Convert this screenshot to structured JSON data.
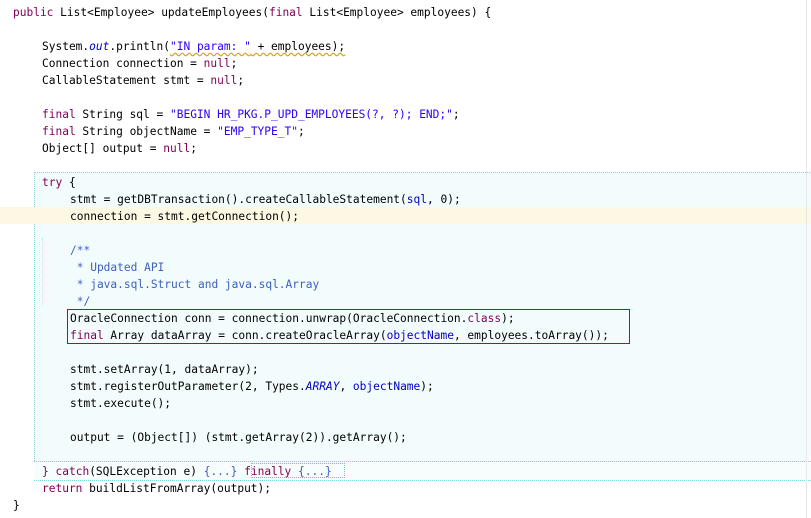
{
  "lines": [
    {
      "id": "l1",
      "segments": [
        {
          "t": "public",
          "c": "kw"
        },
        {
          "t": " List<Employee> updateEmployees(",
          "c": ""
        },
        {
          "t": "final",
          "c": "kw"
        },
        {
          "t": " List<Employee> employees) {",
          "c": ""
        }
      ]
    },
    {
      "id": "l2",
      "segments": [
        {
          "t": "System.",
          "c": ""
        },
        {
          "t": "out",
          "c": "static-field"
        },
        {
          "t": ".println(",
          "c": ""
        },
        {
          "t": "\"IN param: \"",
          "c": "str squiggle"
        },
        {
          "t": " + employees);",
          "c": "squiggle"
        }
      ]
    },
    {
      "id": "l3",
      "segments": [
        {
          "t": "Connection connection = ",
          "c": ""
        },
        {
          "t": "null",
          "c": "kw"
        },
        {
          "t": ";",
          "c": ""
        }
      ]
    },
    {
      "id": "l4",
      "segments": [
        {
          "t": "CallableStatement stmt = ",
          "c": ""
        },
        {
          "t": "null",
          "c": "kw"
        },
        {
          "t": ";",
          "c": ""
        }
      ]
    },
    {
      "id": "l5",
      "segments": [
        {
          "t": "final",
          "c": "kw"
        },
        {
          "t": " String sql = ",
          "c": ""
        },
        {
          "t": "\"BEGIN HR_PKG.P_UPD_EMPLOYEES(?, ?); END;\"",
          "c": "str"
        },
        {
          "t": ";",
          "c": ""
        }
      ]
    },
    {
      "id": "l6",
      "segments": [
        {
          "t": "final",
          "c": "kw"
        },
        {
          "t": " String objectName = ",
          "c": ""
        },
        {
          "t": "\"EMP_TYPE_T\"",
          "c": "str"
        },
        {
          "t": ";",
          "c": ""
        }
      ]
    },
    {
      "id": "l7",
      "segments": [
        {
          "t": "Object[] output = ",
          "c": ""
        },
        {
          "t": "null",
          "c": "kw"
        },
        {
          "t": ";",
          "c": ""
        }
      ]
    },
    {
      "id": "l8",
      "segments": [
        {
          "t": "try",
          "c": "kw"
        },
        {
          "t": " {",
          "c": ""
        }
      ]
    },
    {
      "id": "l9",
      "segments": [
        {
          "t": "stmt = getDBTransaction().createCallableStatement(",
          "c": ""
        },
        {
          "t": "sql",
          "c": "field"
        },
        {
          "t": ", 0);",
          "c": ""
        }
      ]
    },
    {
      "id": "l10",
      "segments": [
        {
          "t": "connection = stmt.getConnection();",
          "c": ""
        }
      ]
    },
    {
      "id": "l11",
      "segments": [
        {
          "t": "/**",
          "c": "comment"
        }
      ]
    },
    {
      "id": "l12",
      "segments": [
        {
          "t": " * Updated API",
          "c": "comment"
        }
      ]
    },
    {
      "id": "l13",
      "segments": [
        {
          "t": " * java.sql.Struct and java.sql.Array",
          "c": "comment"
        }
      ]
    },
    {
      "id": "l14",
      "segments": [
        {
          "t": " */",
          "c": "comment"
        }
      ]
    },
    {
      "id": "l15",
      "segments": [
        {
          "t": "OracleConnection conn = connection.unwrap(OracleConnection.",
          "c": ""
        },
        {
          "t": "class",
          "c": "kw"
        },
        {
          "t": ");",
          "c": ""
        }
      ]
    },
    {
      "id": "l16",
      "segments": [
        {
          "t": "final",
          "c": "kw"
        },
        {
          "t": " Array dataArray = conn.createOracleArray(",
          "c": ""
        },
        {
          "t": "objectName",
          "c": "field"
        },
        {
          "t": ", employees.toArray());",
          "c": ""
        }
      ]
    },
    {
      "id": "l17",
      "segments": [
        {
          "t": "stmt.setArray(1, dataArray);",
          "c": ""
        }
      ]
    },
    {
      "id": "l18",
      "segments": [
        {
          "t": "stmt.registerOutParameter(2, Types.",
          "c": ""
        },
        {
          "t": "ARRAY",
          "c": "static-field"
        },
        {
          "t": ", ",
          "c": ""
        },
        {
          "t": "objectName",
          "c": "field"
        },
        {
          "t": ");",
          "c": ""
        }
      ]
    },
    {
      "id": "l19",
      "segments": [
        {
          "t": "stmt.execute();",
          "c": ""
        }
      ]
    },
    {
      "id": "l20",
      "segments": [
        {
          "t": "output = (Object[]) (stmt.getArray(2)).getArray();",
          "c": ""
        }
      ]
    },
    {
      "id": "l21",
      "segments": [
        {
          "t": "}",
          "c": "kw"
        },
        {
          "t": " ",
          "c": ""
        },
        {
          "t": "catch",
          "c": "kw"
        },
        {
          "t": "(SQLException e) ",
          "c": ""
        },
        {
          "t": "{...}",
          "c": "fold"
        },
        {
          "t": " ",
          "c": ""
        },
        {
          "t": "finally",
          "c": "kw"
        },
        {
          "t": " ",
          "c": ""
        },
        {
          "t": "{...}",
          "c": "fold"
        }
      ]
    },
    {
      "id": "l22",
      "segments": [
        {
          "t": "return",
          "c": "kw"
        },
        {
          "t": " buildListFromArray(output);",
          "c": ""
        }
      ]
    },
    {
      "id": "l23",
      "segments": [
        {
          "t": "}",
          "c": ""
        }
      ]
    }
  ]
}
